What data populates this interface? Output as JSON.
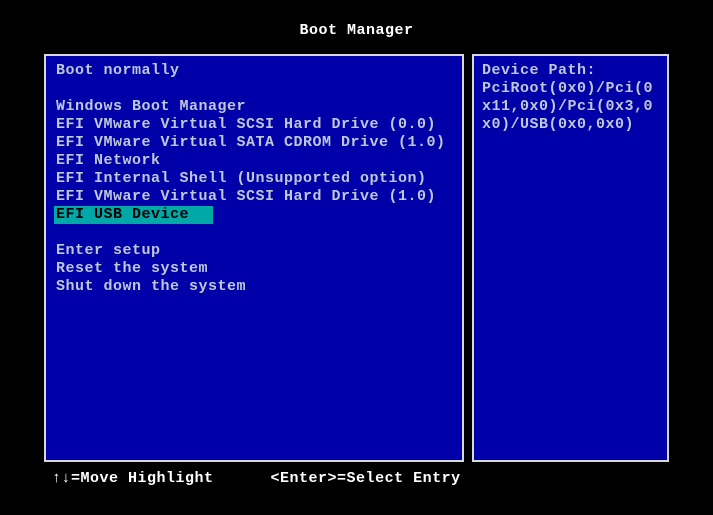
{
  "header": {
    "title": "Boot Manager"
  },
  "menu": {
    "groups": [
      {
        "items": [
          {
            "label": "Boot normally",
            "selected": false
          }
        ]
      },
      {
        "items": [
          {
            "label": "Windows Boot Manager",
            "selected": false
          },
          {
            "label": "EFI VMware Virtual SCSI Hard Drive (0.0)",
            "selected": false
          },
          {
            "label": "EFI VMware Virtual SATA CDROM Drive (1.0)",
            "selected": false
          },
          {
            "label": "EFI Network",
            "selected": false
          },
          {
            "label": "EFI Internal Shell (Unsupported option)",
            "selected": false
          },
          {
            "label": "EFI VMware Virtual SCSI Hard Drive (1.0)",
            "selected": false
          },
          {
            "label": "EFI USB Device",
            "selected": true
          }
        ]
      },
      {
        "items": [
          {
            "label": "Enter setup",
            "selected": false
          },
          {
            "label": "Reset the system",
            "selected": false
          },
          {
            "label": "Shut down the system",
            "selected": false
          }
        ]
      }
    ]
  },
  "side": {
    "heading": "Device Path:",
    "path": "PciRoot(0x0)/Pci(0x11,0x0)/Pci(0x3,0x0)/USB(0x0,0x0)"
  },
  "footer": {
    "move": "↑↓=Move Highlight",
    "enter": "<Enter>=Select Entry"
  }
}
